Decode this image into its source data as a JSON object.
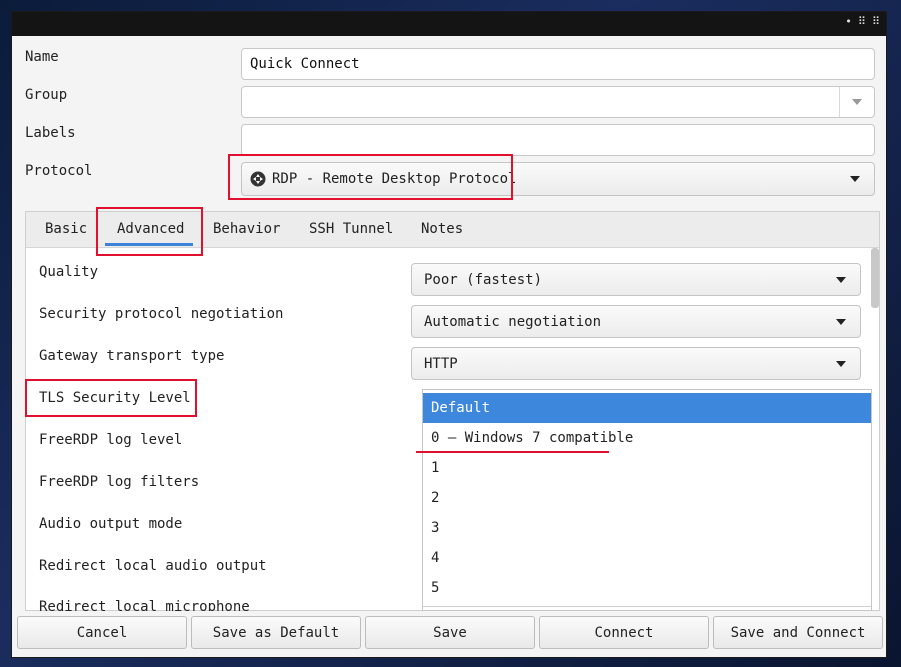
{
  "form": {
    "name_label": "Name",
    "name_value": "Quick Connect",
    "group_label": "Group",
    "group_value": "",
    "labels_label": "Labels",
    "labels_value": "",
    "protocol_label": "Protocol",
    "protocol_value": "RDP - Remote Desktop Protocol"
  },
  "tabs": [
    {
      "label": "Basic"
    },
    {
      "label": "Advanced"
    },
    {
      "label": "Behavior"
    },
    {
      "label": "SSH Tunnel"
    },
    {
      "label": "Notes"
    }
  ],
  "active_tab": "Advanced",
  "settings": {
    "quality_label": "Quality",
    "quality_value": "Poor (fastest)",
    "security_label": "Security protocol negotiation",
    "security_value": "Automatic negotiation",
    "gateway_label": "Gateway transport type",
    "gateway_value": "HTTP",
    "tls_label": "TLS Security Level",
    "log_level_label": "FreeRDP log level",
    "log_filters_label": "FreeRDP log filters",
    "audio_label": "Audio output mode",
    "redirect_audio_label": "Redirect local audio output",
    "redirect_mic_label": "Redirect local microphone"
  },
  "tls_options": [
    {
      "label": "Default"
    },
    {
      "label": "0 — Windows 7 compatible"
    },
    {
      "label": "1"
    },
    {
      "label": "2"
    },
    {
      "label": "3"
    },
    {
      "label": "4"
    },
    {
      "label": "5"
    }
  ],
  "tls_selected": "Default",
  "buttons": {
    "cancel": "Cancel",
    "save_default": "Save as Default",
    "save": "Save",
    "connect": "Connect",
    "save_connect": "Save and Connect"
  },
  "window_controls": [
    "•",
    "⠿",
    "⠿"
  ],
  "colors": {
    "accent": "#3d87dd",
    "highlight": "#e0102e"
  }
}
